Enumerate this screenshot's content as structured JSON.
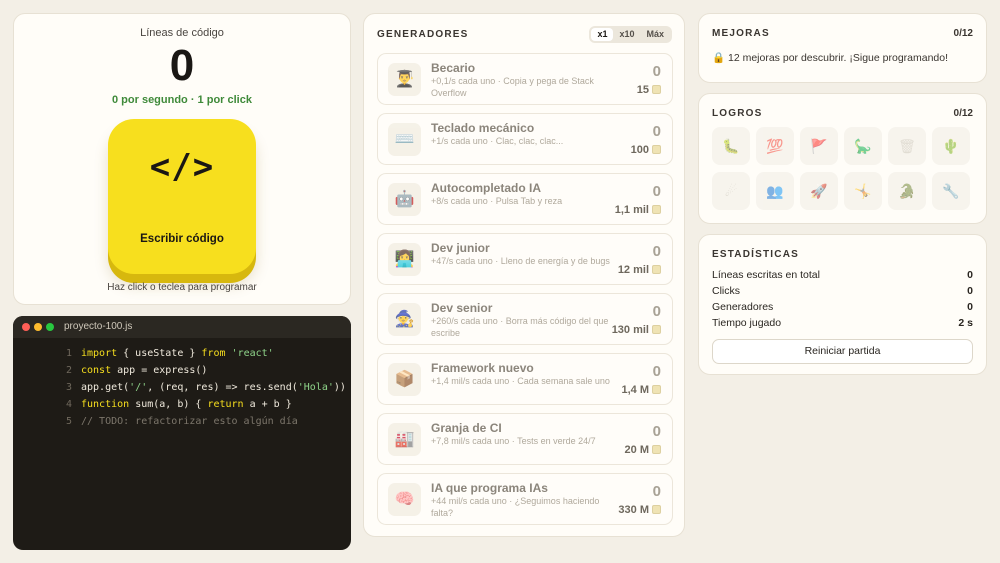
{
  "clicker": {
    "label": "Líneas de código",
    "count": "0",
    "rate": "0 por segundo · 1 por click",
    "button_glyph": "</>",
    "button_label": "Escribir código",
    "hint": "Haz click o teclea para programar"
  },
  "editor": {
    "filename": "proyecto-100.js",
    "lines": [
      {
        "n": "1",
        "parts": [
          {
            "t": "import",
            "c": "kw"
          },
          {
            "t": " { useState } ",
            "c": ""
          },
          {
            "t": "from",
            "c": "kw"
          },
          {
            "t": " ",
            "c": ""
          },
          {
            "t": "'react'",
            "c": "str"
          }
        ]
      },
      {
        "n": "2",
        "parts": [
          {
            "t": "const",
            "c": "kw"
          },
          {
            "t": " app = express()",
            "c": ""
          }
        ]
      },
      {
        "n": "3",
        "parts": [
          {
            "t": "app.get(",
            "c": ""
          },
          {
            "t": "'/'",
            "c": "str"
          },
          {
            "t": ", (req, res) => res.send(",
            "c": ""
          },
          {
            "t": "'Hola'",
            "c": "str"
          },
          {
            "t": "))",
            "c": ""
          }
        ]
      },
      {
        "n": "4",
        "parts": [
          {
            "t": "function",
            "c": "kw"
          },
          {
            "t": " sum(a, b) { ",
            "c": ""
          },
          {
            "t": "return",
            "c": "kw"
          },
          {
            "t": " a + b }",
            "c": ""
          }
        ]
      },
      {
        "n": "5",
        "parts": [
          {
            "t": "// TODO: refactorizar esto algún día",
            "c": "cm"
          }
        ]
      }
    ]
  },
  "generators": {
    "title": "GENERADORES",
    "multipliers": [
      {
        "label": "x1",
        "active": true
      },
      {
        "label": "x10",
        "active": false
      },
      {
        "label": "Máx",
        "active": false
      }
    ],
    "items": [
      {
        "icon": "👨‍🎓",
        "name": "Becario",
        "desc": "+0,1/s cada uno · Copia y pega de Stack Overflow",
        "owned": "0",
        "cost": "15"
      },
      {
        "icon": "⌨️",
        "name": "Teclado mecánico",
        "desc": "+1/s cada uno · Clac, clac, clac...",
        "owned": "0",
        "cost": "100"
      },
      {
        "icon": "🤖",
        "name": "Autocompletado IA",
        "desc": "+8/s cada uno · Pulsa Tab y reza",
        "owned": "0",
        "cost": "1,1 mil"
      },
      {
        "icon": "👩‍💻",
        "name": "Dev junior",
        "desc": "+47/s cada uno · Lleno de energía y de bugs",
        "owned": "0",
        "cost": "12 mil"
      },
      {
        "icon": "🧙",
        "name": "Dev senior",
        "desc": "+260/s cada uno · Borra más código del que escribe",
        "owned": "0",
        "cost": "130 mil"
      },
      {
        "icon": "📦",
        "name": "Framework nuevo",
        "desc": "+1,4 mil/s cada uno · Cada semana sale uno",
        "owned": "0",
        "cost": "1,4 M"
      },
      {
        "icon": "🏭",
        "name": "Granja de CI",
        "desc": "+7,8 mil/s cada uno · Tests en verde 24/7",
        "owned": "0",
        "cost": "20 M"
      },
      {
        "icon": "🧠",
        "name": "IA que programa IAs",
        "desc": "+44 mil/s cada uno · ¿Seguimos haciendo falta?",
        "owned": "0",
        "cost": "330 M"
      }
    ]
  },
  "upgrades": {
    "title": "MEJORAS",
    "count": "0/12",
    "message": "🔒 12 mejoras por descubrir. ¡Sigue programando!"
  },
  "achievements": {
    "title": "LOGROS",
    "count": "0/12",
    "icons": [
      "🐛",
      "💯",
      "🚩",
      "🦕",
      "🗑",
      "🌵",
      "☄",
      "👥",
      "🚀",
      "🤸",
      "🐊",
      "🔧"
    ]
  },
  "stats": {
    "title": "ESTADÍSTICAS",
    "rows": [
      {
        "label": "Líneas escritas en total",
        "value": "0"
      },
      {
        "label": "Clicks",
        "value": "0"
      },
      {
        "label": "Generadores",
        "value": "0"
      },
      {
        "label": "Tiempo jugado",
        "value": "2 s"
      }
    ],
    "reset_label": "Reiniciar partida"
  }
}
